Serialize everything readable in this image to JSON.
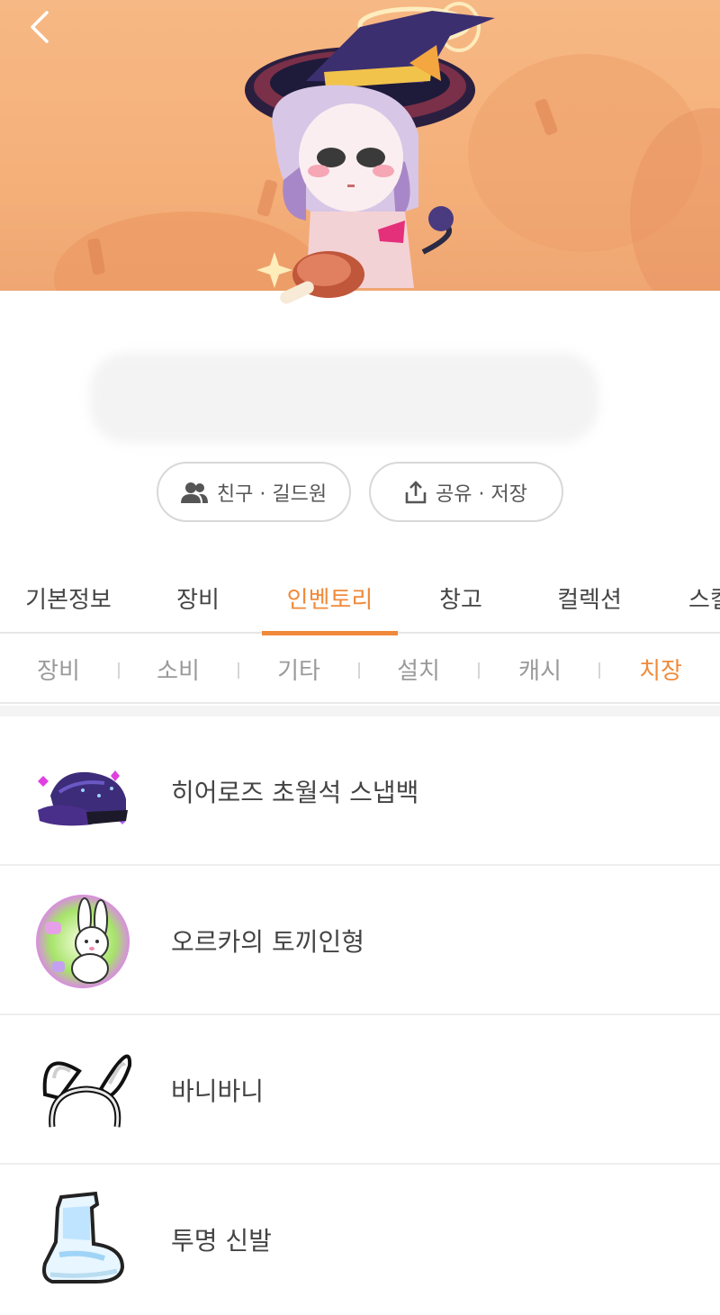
{
  "header": {
    "back_icon": "chevron-left-icon"
  },
  "actions": {
    "friends_label": "친구 · 길드원",
    "friends_icon": "people-icon",
    "share_label": "공유 · 저장",
    "share_icon": "share-icon"
  },
  "main_tabs": [
    {
      "label": "기본정보",
      "active": false
    },
    {
      "label": "장비",
      "active": false
    },
    {
      "label": "인벤토리",
      "active": true
    },
    {
      "label": "창고",
      "active": false
    },
    {
      "label": "컬렉션",
      "active": false
    },
    {
      "label": "스킬",
      "active": false
    }
  ],
  "sub_tabs": [
    {
      "label": "장비",
      "active": false
    },
    {
      "label": "소비",
      "active": false
    },
    {
      "label": "기타",
      "active": false
    },
    {
      "label": "설치",
      "active": false
    },
    {
      "label": "캐시",
      "active": false
    },
    {
      "label": "치장",
      "active": true
    }
  ],
  "items": [
    {
      "name": "히어로즈 초월석 스냅백",
      "icon": "purple-snapback-cap-icon"
    },
    {
      "name": "오르카의 토끼인형",
      "icon": "bunny-doll-icon"
    },
    {
      "name": "바니바니",
      "icon": "bunny-ears-headband-icon"
    },
    {
      "name": "투명 신발",
      "icon": "transparent-shoe-icon"
    }
  ],
  "colors": {
    "accent": "#f08a3a",
    "banner": "#f5b07a"
  }
}
